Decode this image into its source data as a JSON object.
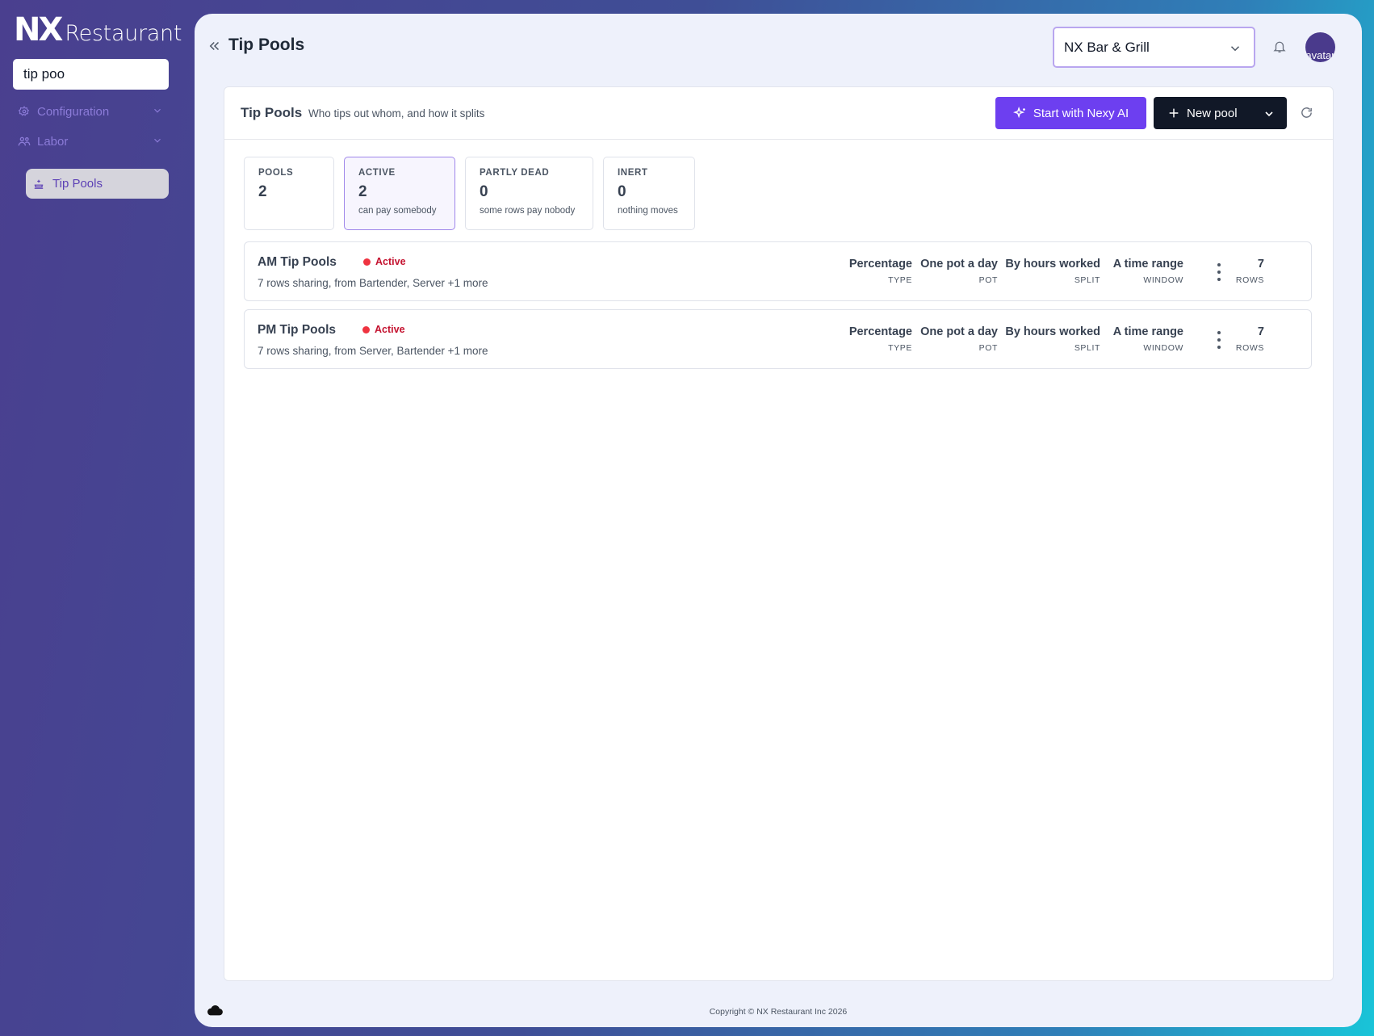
{
  "brand": {
    "mark": "NX",
    "name": "Restaurant"
  },
  "sidebar": {
    "search_value": "tip poo",
    "groups": [
      {
        "label": "Configuration",
        "icon": "gear-icon"
      },
      {
        "label": "Labor",
        "icon": "people-icon"
      }
    ],
    "active_item": {
      "label": "Tip Pools",
      "icon": "tip-jar-icon"
    }
  },
  "header": {
    "title": "Tip Pools",
    "venue": "NX Bar & Grill",
    "avatar_alt": "avatar"
  },
  "card": {
    "title": "Tip Pools",
    "subtitle": "Who tips out whom, and how it splits",
    "ai_button": "Start with Nexy AI",
    "new_button": "New pool"
  },
  "stats": [
    {
      "label": "POOLS",
      "value": "2",
      "note": ""
    },
    {
      "label": "ACTIVE",
      "value": "2",
      "note": "can pay somebody",
      "selected": true
    },
    {
      "label": "PARTLY DEAD",
      "value": "0",
      "note": "some rows pay nobody"
    },
    {
      "label": "INERT",
      "value": "0",
      "note": "nothing moves"
    }
  ],
  "pools": [
    {
      "name": "AM Tip Pools",
      "status": "Active",
      "description": "7 rows sharing, from Bartender, Server +1 more",
      "type": "Percentage",
      "type_label": "TYPE",
      "pot": "One pot a day",
      "pot_label": "POT",
      "split": "By hours worked",
      "split_label": "SPLIT",
      "window": "A time range",
      "window_label": "WINDOW",
      "rows": "7",
      "rows_label": "ROWS"
    },
    {
      "name": "PM Tip Pools",
      "status": "Active",
      "description": "7 rows sharing, from Server, Bartender +1 more",
      "type": "Percentage",
      "type_label": "TYPE",
      "pot": "One pot a day",
      "pot_label": "POT",
      "split": "By hours worked",
      "split_label": "SPLIT",
      "window": "A time range",
      "window_label": "WINDOW",
      "rows": "7",
      "rows_label": "ROWS"
    }
  ],
  "footer": {
    "copyright": "Copyright © NX Restaurant Inc 2026"
  },
  "colors": {
    "accent": "#6d3ff0",
    "dark_button": "#111827",
    "status_active": "#c4122f"
  }
}
